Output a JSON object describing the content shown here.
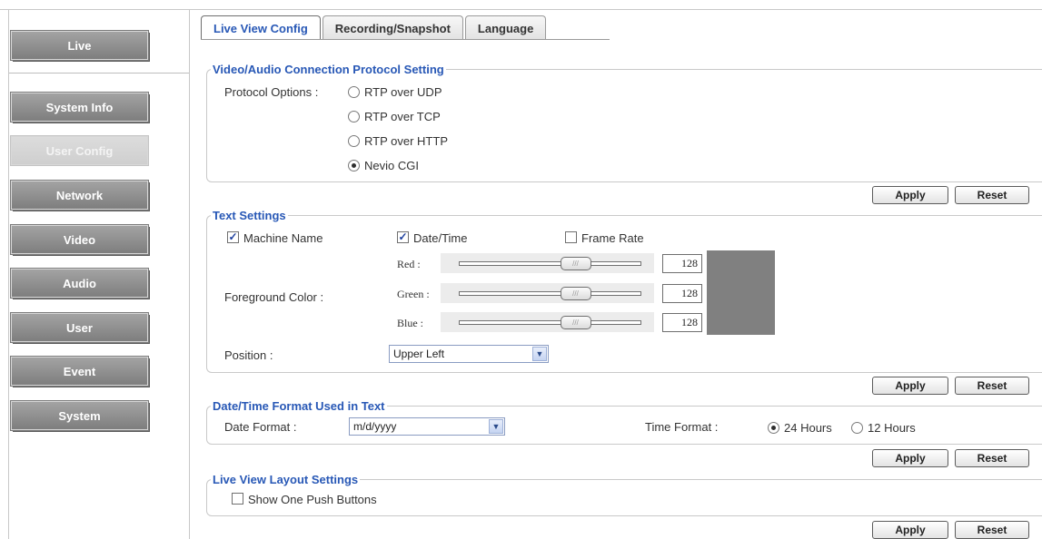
{
  "sidebar": {
    "items": [
      {
        "label": "Live",
        "active": false
      },
      {
        "label": "System Info",
        "active": false
      },
      {
        "label": "User Config",
        "active": true
      },
      {
        "label": "Network",
        "active": false
      },
      {
        "label": "Video",
        "active": false
      },
      {
        "label": "Audio",
        "active": false
      },
      {
        "label": "User",
        "active": false
      },
      {
        "label": "Event",
        "active": false
      },
      {
        "label": "System",
        "active": false
      }
    ]
  },
  "tabs": [
    {
      "label": "Live View Config",
      "active": true
    },
    {
      "label": "Recording/Snapshot",
      "active": false
    },
    {
      "label": "Language",
      "active": false
    }
  ],
  "protocol": {
    "legend": "Video/Audio Connection Protocol Setting",
    "label": "Protocol Options :",
    "options": [
      "RTP over UDP",
      "RTP over TCP",
      "RTP over HTTP",
      "Nevio CGI"
    ],
    "selected": "Nevio CGI"
  },
  "text_settings": {
    "legend": "Text Settings",
    "machine_name": {
      "label": "Machine Name",
      "checked": true
    },
    "date_time": {
      "label": "Date/Time",
      "checked": true
    },
    "frame_rate": {
      "label": "Frame Rate",
      "checked": false
    },
    "foreground_label": "Foreground Color :",
    "red": {
      "label": "Red :",
      "value": "128"
    },
    "green": {
      "label": "Green :",
      "value": "128"
    },
    "blue": {
      "label": "Blue :",
      "value": "128"
    },
    "slider_value_fraction": 0.5,
    "swatch_color": "#808080",
    "position_label": "Position :",
    "position_value": "Upper Left"
  },
  "date_time_format": {
    "legend": "Date/Time Format Used in Text",
    "date_label": "Date Format :",
    "date_value": "m/d/yyyy",
    "time_label": "Time Format :",
    "time_24": "24 Hours",
    "time_12": "12 Hours",
    "time_selected": "24 Hours"
  },
  "layout_settings": {
    "legend": "Live View Layout Settings",
    "show_one_push": {
      "label": "Show One Push Buttons",
      "checked": false
    }
  },
  "buttons": {
    "apply": "Apply",
    "reset": "Reset"
  },
  "colors": {
    "accent": "#2858b6",
    "nav_button": "#8a8a8a",
    "nav_active": "#d4d4d4"
  }
}
